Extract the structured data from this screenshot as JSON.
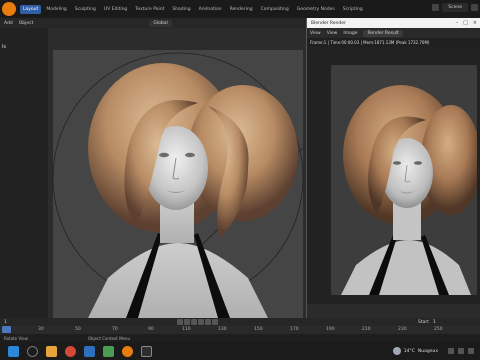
{
  "app": {
    "workspace_tabs": [
      "Layout",
      "Modeling",
      "Sculpting",
      "UV Editing",
      "Texture Paint",
      "Shading",
      "Animation",
      "Rendering",
      "Compositing",
      "Geometry Nodes",
      "Scripting"
    ],
    "active_tab": 0,
    "scene_label": "Scene"
  },
  "viewport_header": {
    "menu": [
      "Add",
      "Object"
    ],
    "orientation": "Global"
  },
  "outliner": {
    "mode_label": "ls"
  },
  "render_window": {
    "title": "Blender Render",
    "menu": [
      "View",
      "View",
      "Image"
    ],
    "slot": "Render Result",
    "info": "Frame:1 | Time:00:00.03 | Mem:1871.13M (Peak 1732.70M)"
  },
  "timeline": {
    "current_frame": "1",
    "start_label": "Start",
    "start_value": "1"
  },
  "frame_ruler": {
    "numbers": [
      "30",
      "50",
      "70",
      "90",
      "110",
      "130",
      "150",
      "170",
      "190",
      "210",
      "230",
      "250"
    ]
  },
  "statusbar": {
    "left": "Rotate View",
    "middle": "Object Context Menu"
  },
  "taskbar": {
    "weather_temp": "14°C",
    "weather_text": "Nuageux"
  },
  "colors": {
    "accent": "#2f5fa6",
    "blender_orange": "#e87d0d"
  }
}
